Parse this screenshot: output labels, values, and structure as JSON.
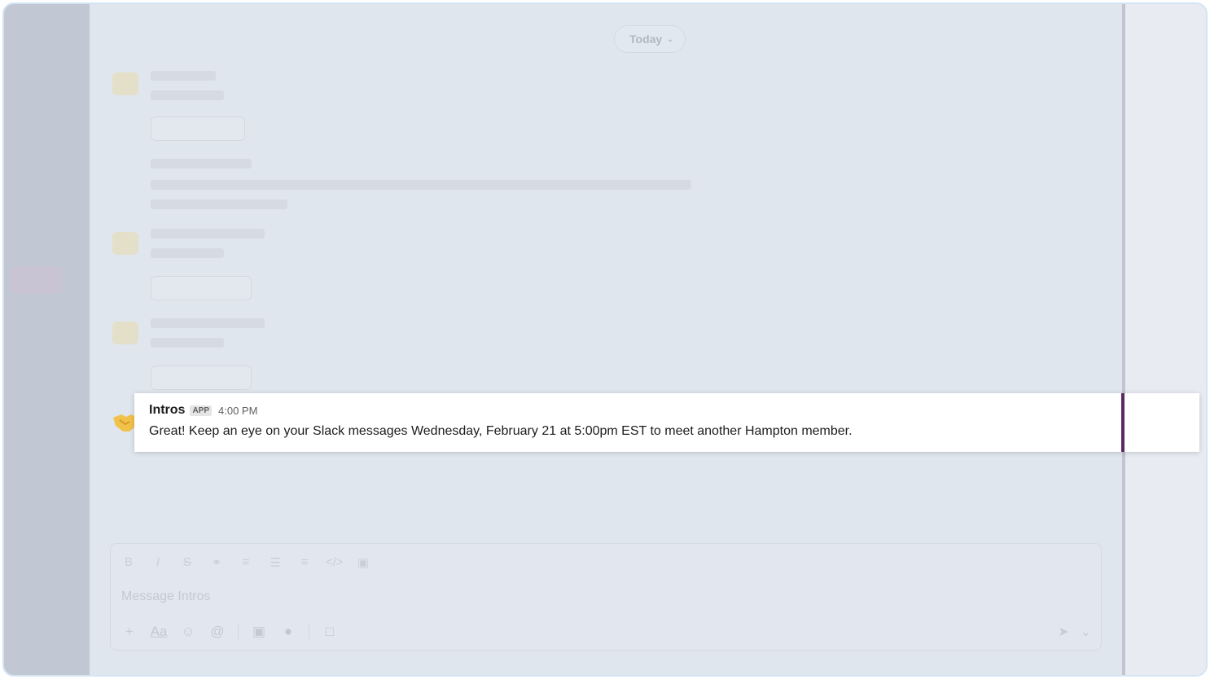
{
  "divider": {
    "label": "Today"
  },
  "message": {
    "sender": "Intros",
    "badge": "APP",
    "time": "4:00 PM",
    "text": "Great! Keep an eye on your Slack messages Wednesday, February 21 at 5:00pm EST to meet another Hampton member."
  },
  "composer": {
    "placeholder": "Message Intros"
  },
  "colors": {
    "accent": "#5c2763",
    "sidebar": "#c1c8d4",
    "main_bg": "#e0e6ee"
  },
  "icons": {
    "format": [
      "bold-icon",
      "italic-icon",
      "strikethrough-icon",
      "link-icon",
      "ordered-list-icon",
      "bulleted-list-icon",
      "numbered-list-icon",
      "code-icon",
      "code-block-icon"
    ],
    "tools": [
      "plus-icon",
      "text-format-icon",
      "emoji-icon",
      "mention-icon",
      "video-icon",
      "microphone-icon",
      "slash-command-icon"
    ]
  }
}
